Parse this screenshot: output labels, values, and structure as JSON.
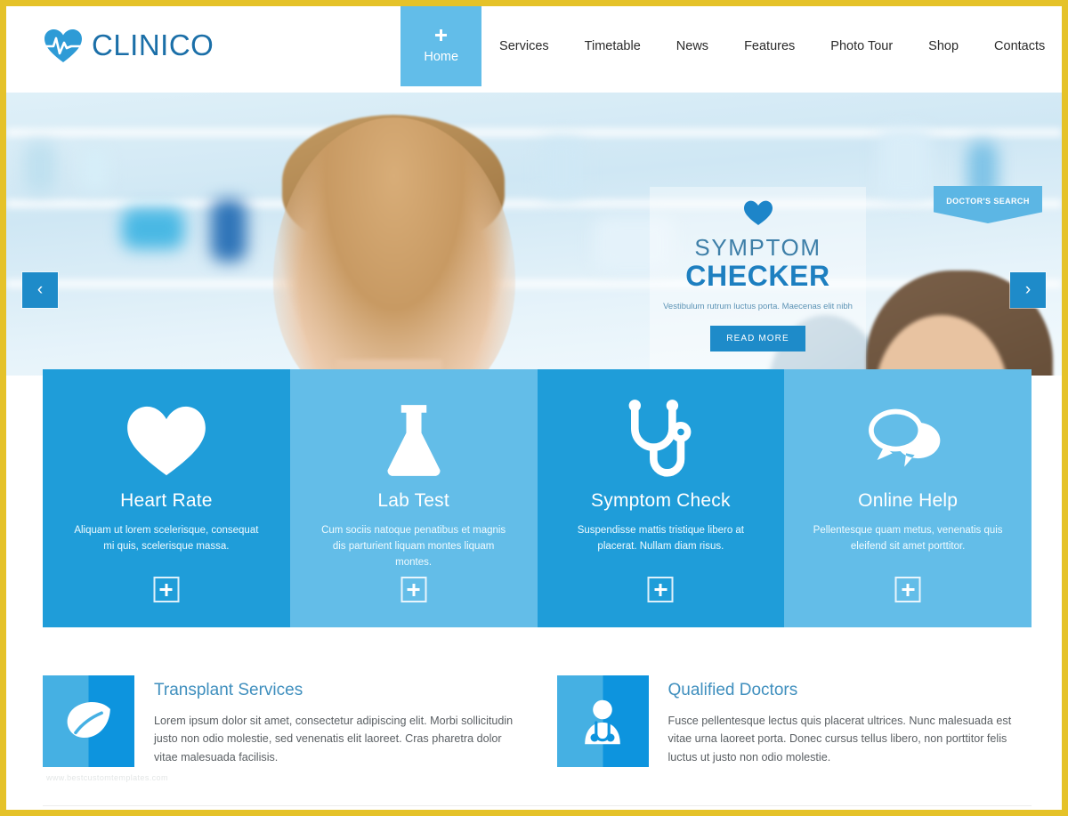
{
  "brand": {
    "name": "CLINICO",
    "logo_icon": "heart-pulse-icon",
    "logo_color": "#1b6fa8",
    "accent_color": "#1e8bc9"
  },
  "nav": {
    "items": [
      {
        "label": "Home",
        "active": true,
        "icon": "plus-icon"
      },
      {
        "label": "Services",
        "active": false
      },
      {
        "label": "Timetable",
        "active": false
      },
      {
        "label": "News",
        "active": false
      },
      {
        "label": "Features",
        "active": false
      },
      {
        "label": "Photo Tour",
        "active": false
      },
      {
        "label": "Shop",
        "active": false
      },
      {
        "label": "Contacts",
        "active": false
      }
    ]
  },
  "hero": {
    "doctor_search_label": "DOCTOR'S SEARCH",
    "heart_icon": "heart-icon",
    "title_line1": "SYMPTOM",
    "title_line2": "CHECKER",
    "subtitle": "Vestibulum rutrum luctus porta. Maecenas elit nibh",
    "button_label": "READ MORE",
    "prev_arrow": "‹",
    "next_arrow": "›"
  },
  "cards": [
    {
      "icon": "heart-icon",
      "title": "Heart Rate",
      "desc": "Aliquam ut lorem scelerisque, consequat mi quis, scelerisque massa.",
      "tone": "dark",
      "bg": "#1f9dd9",
      "plus_icon": "plus-icon"
    },
    {
      "icon": "flask-icon",
      "title": "Lab Test",
      "desc": "Cum sociis natoque penatibus et magnis dis parturient liquam montes liquam montes.",
      "tone": "light",
      "bg": "#63bde8",
      "plus_icon": "plus-icon"
    },
    {
      "icon": "stethoscope-icon",
      "title": "Symptom Check",
      "desc": "Suspendisse mattis tristique libero at placerat. Nullam diam risus.",
      "tone": "dark",
      "bg": "#1f9dd9",
      "plus_icon": "plus-icon"
    },
    {
      "icon": "chat-bubbles-icon",
      "title": "Online Help",
      "desc": "Pellentesque quam metus, venenatis quis eleifend sit amet porttitor.",
      "tone": "light",
      "bg": "#63bde8",
      "plus_icon": "plus-icon"
    }
  ],
  "services": [
    {
      "icon": "leaf-icon",
      "title": "Transplant Services",
      "desc": "Lorem ipsum dolor sit amet, consectetur adipiscing elit. Morbi sollicitudin justo non odio molestie, sed venenatis elit laoreet. Cras pharetra dolor vitae malesuada facilisis."
    },
    {
      "icon": "doctor-icon",
      "title": "Qualified Doctors",
      "desc": "Fusce pellentesque lectus quis placerat ultrices. Nunc malesuada est vitae urna laoreet porta. Donec cursus tellus libero, non porttitor felis luctus ut justo non odio molestie."
    }
  ],
  "watermark": "www.bestcustomtemplates.com"
}
